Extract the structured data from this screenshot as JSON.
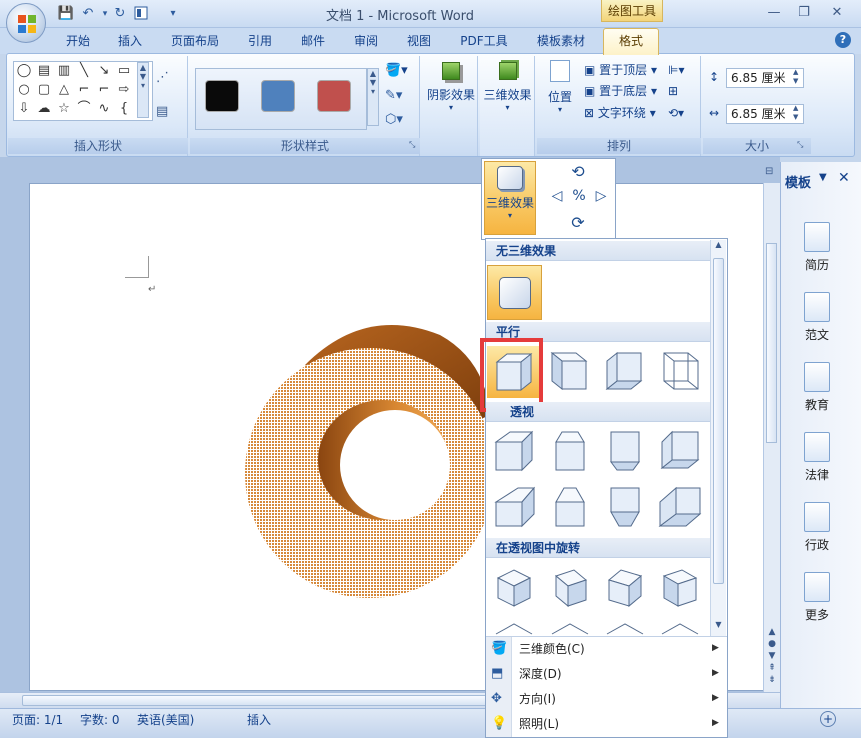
{
  "app": {
    "title": "文档 1 - Microsoft Word",
    "contextual_tab_group": "绘图工具"
  },
  "quick_access": {
    "save": "💾",
    "undo": "↶",
    "redo": "↻",
    "customize": "▾"
  },
  "tabs": [
    {
      "label": "开始"
    },
    {
      "label": "插入"
    },
    {
      "label": "页面布局"
    },
    {
      "label": "引用"
    },
    {
      "label": "邮件"
    },
    {
      "label": "审阅"
    },
    {
      "label": "视图"
    },
    {
      "label": "PDF工具"
    },
    {
      "label": "模板素材"
    },
    {
      "label": "格式"
    }
  ],
  "ribbon": {
    "insert_shapes": {
      "label": "插入形状"
    },
    "shape_styles": {
      "label": "形状样式",
      "swatches": [
        "#0a0a0a",
        "#4f81bd",
        "#c0504d"
      ]
    },
    "shadow_effects": {
      "label": "阴影效果"
    },
    "effects_3d": {
      "label": "三维效果"
    },
    "arrange": {
      "label": "排列",
      "position": "位置",
      "bring_to_front": "置于顶层",
      "send_to_back": "置于底层",
      "text_wrapping": "文字环绕"
    },
    "size": {
      "label": "大小",
      "height": "6.85 厘米",
      "width": "6.85 厘米"
    }
  },
  "dropdown": {
    "header_button": "三维效果",
    "sections": {
      "none": "无三维效果",
      "parallel": "平行",
      "perspective": "透视",
      "rotate_perspective": "在透视图中旋转"
    },
    "menu": [
      {
        "label": "三维颜色(C)"
      },
      {
        "label": "深度(D)"
      },
      {
        "label": "方向(I)"
      },
      {
        "label": "照明(L)"
      }
    ]
  },
  "template_pane": {
    "title": "模板",
    "items": [
      {
        "label": "简历"
      },
      {
        "label": "范文"
      },
      {
        "label": "教育"
      },
      {
        "label": "法律"
      },
      {
        "label": "行政"
      },
      {
        "label": "更多"
      }
    ]
  },
  "status": {
    "page": "页面: 1/1",
    "words": "字数: 0",
    "language": "英语(美国)",
    "mode": "插入"
  },
  "colors": {
    "ring": "#d6893a",
    "ring_dark": "#9c4f10",
    "highlight_border": "#e53b3b"
  }
}
